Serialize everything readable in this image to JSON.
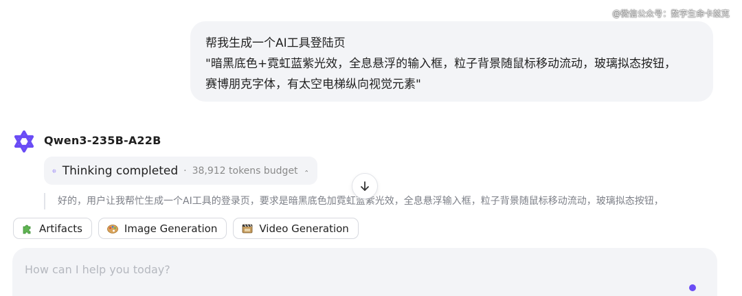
{
  "watermark": "@微信公众号：数字生命卡兹克",
  "user_message": {
    "lines": [
      "帮我生成一个AI工具登陆页",
      "\"暗黑底色+霓虹蓝紫光效，全息悬浮的输入框，粒子背景随鼠标移动流动，玻璃拟态按钮，",
      "赛博朋克字体，有太空电梯纵向视觉元素\""
    ]
  },
  "assistant": {
    "model_name": "Qwen3-235B-A22B",
    "thinking": {
      "title": "Thinking completed",
      "separator": "·",
      "budget": "38,912 tokens budget"
    },
    "thought_preview": "好的，用户让我帮忙生成一个AI工具的登录页，要求是暗黑底色加霓虹蓝紫光效，全息悬浮输入框，粒子背景随鼠标移动流动，玻璃拟态按钮，"
  },
  "chips": [
    {
      "label": "Artifacts",
      "icon": "puzzle-icon"
    },
    {
      "label": "Image Generation",
      "icon": "palette-icon"
    },
    {
      "label": "Video Generation",
      "icon": "film-icon"
    }
  ],
  "composer": {
    "placeholder": "How can I help you today?",
    "value": ""
  },
  "colors": {
    "accent": "#6a4cf5",
    "logo": "#6a4cf5",
    "bubble_bg": "#f3f4f7",
    "muted_text": "#7c7f87"
  }
}
